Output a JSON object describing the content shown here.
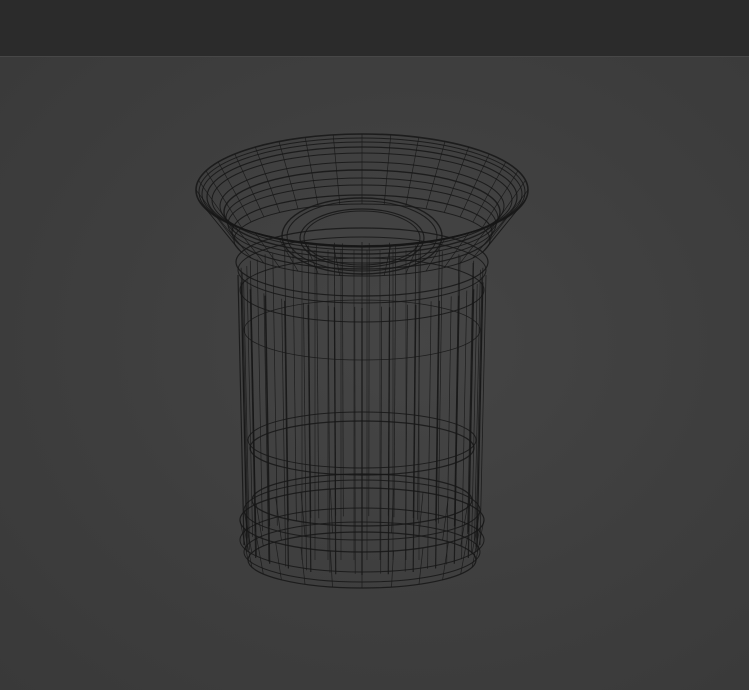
{
  "app": {
    "header": {},
    "viewport": {
      "object_icon": "wireframe-trash-can-icon",
      "colors": {
        "background": "#3d3d3d",
        "header": "#2b2b2b",
        "wire": "#161616"
      }
    }
  }
}
